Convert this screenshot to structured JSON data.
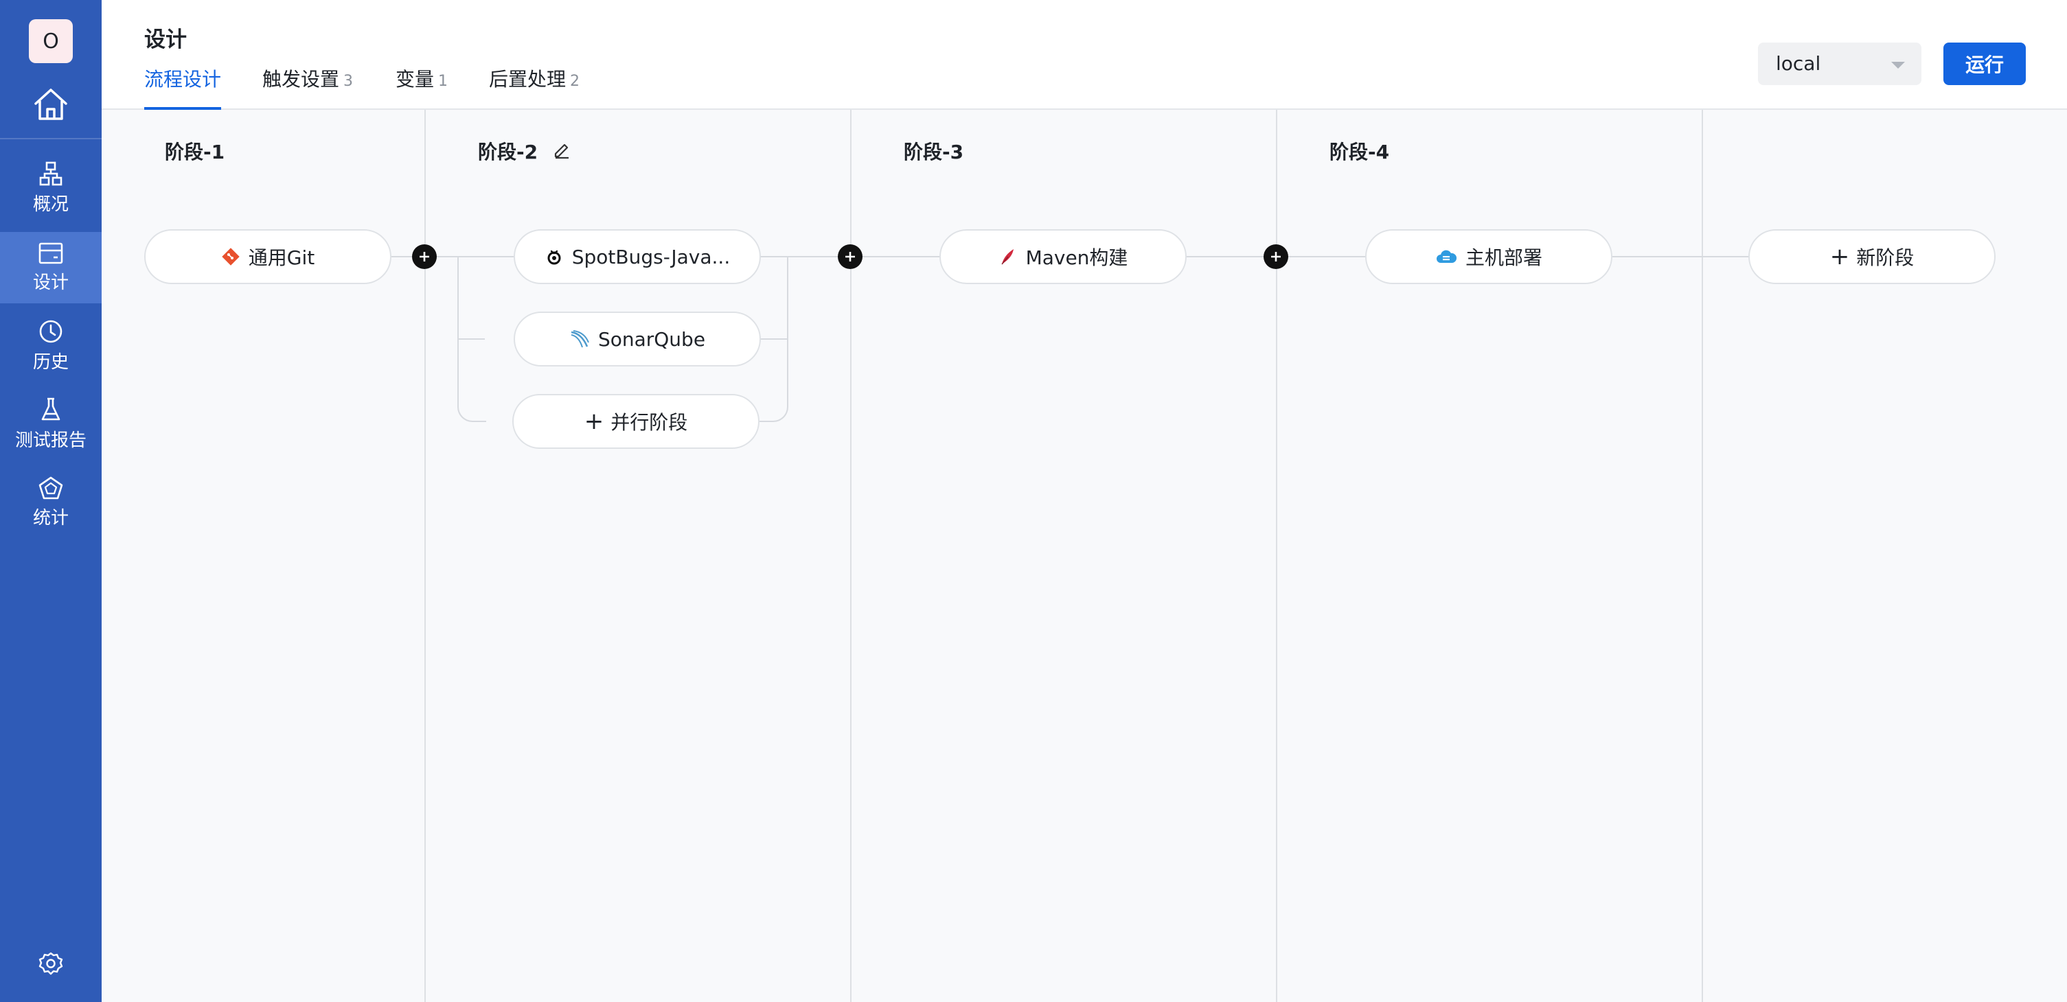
{
  "sidebar": {
    "avatar_letter": "O",
    "nav": [
      {
        "label": "概况",
        "icon": "overview-icon"
      },
      {
        "label": "设计",
        "icon": "design-icon",
        "active": true
      },
      {
        "label": "历史",
        "icon": "history-icon"
      },
      {
        "label": "测试报告",
        "icon": "test-report-icon"
      },
      {
        "label": "统计",
        "icon": "statistics-icon"
      }
    ]
  },
  "header": {
    "title": "设计",
    "tabs": [
      {
        "label": "流程设计",
        "count": "",
        "active": true
      },
      {
        "label": "触发设置",
        "count": "3"
      },
      {
        "label": "变量",
        "count": "1"
      },
      {
        "label": "后置处理",
        "count": "2"
      }
    ],
    "env_select_value": "local",
    "run_label": "运行"
  },
  "stages": [
    {
      "title": "阶段-1",
      "tasks": [
        {
          "label": "通用Git",
          "icon": "git-icon"
        }
      ]
    },
    {
      "title": "阶段-2",
      "tasks": [
        {
          "label": "SpotBugs-Java...",
          "icon": "spotbugs-icon"
        },
        {
          "label": "SonarQube",
          "icon": "sonarqube-icon"
        }
      ],
      "add_parallel_label": "并行阶段"
    },
    {
      "title": "阶段-3",
      "tasks": [
        {
          "label": "Maven构建",
          "icon": "maven-icon"
        }
      ]
    },
    {
      "title": "阶段-4",
      "tasks": [
        {
          "label": "主机部署",
          "icon": "host-deploy-icon"
        }
      ]
    }
  ],
  "new_stage_label": "新阶段",
  "colors": {
    "sidebar_bg": "#2f5bb7",
    "sidebar_active": "#4b76cf",
    "primary": "#1464e0",
    "canvas_bg": "#f8f9fb"
  }
}
